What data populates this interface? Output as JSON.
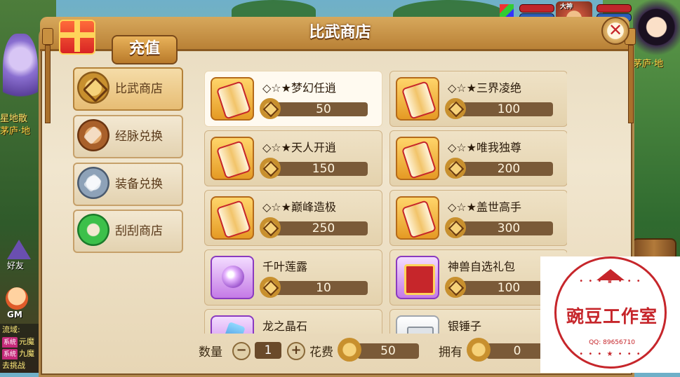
{
  "shop": {
    "title": "比武商店",
    "recharge_label": "充值",
    "close_glyph": "✕"
  },
  "tabs": [
    {
      "label": "比武商店",
      "icon": "crossed-swords-coin-icon",
      "active": true
    },
    {
      "label": "经脉兑换",
      "icon": "bronze-coin-icon",
      "active": false
    },
    {
      "label": "装备兑换",
      "icon": "silver-coin-icon",
      "active": false
    },
    {
      "label": "刮刮商店",
      "icon": "jade-ring-icon",
      "active": false
    }
  ],
  "items": [
    {
      "name": "◇☆★梦幻任逍",
      "price": "50",
      "icon": "scroll-icon"
    },
    {
      "name": "◇☆★三界凌绝",
      "price": "100",
      "icon": "scroll-icon"
    },
    {
      "name": "◇☆★天人开逍",
      "price": "150",
      "icon": "scroll-icon"
    },
    {
      "name": "◇☆★唯我独尊",
      "price": "200",
      "icon": "scroll-icon"
    },
    {
      "name": "◇☆★巅峰造极",
      "price": "250",
      "icon": "scroll-icon"
    },
    {
      "name": "◇☆★盖世高手",
      "price": "300",
      "icon": "scroll-icon"
    },
    {
      "name": "千叶莲露",
      "price": "10",
      "icon": "potion-icon"
    },
    {
      "name": "神兽自选礼包",
      "price": "100",
      "icon": "gift-box-icon"
    },
    {
      "name": "龙之晶石",
      "price": "",
      "icon": "crystal-icon"
    },
    {
      "name": "银锤子",
      "price": "",
      "icon": "hammer-icon"
    }
  ],
  "purchase": {
    "qty_label": "数量",
    "qty_value": "1",
    "minus": "−",
    "plus": "+",
    "cost_label": "花费",
    "cost_value": "50",
    "own_label": "拥有",
    "own_value": "0"
  },
  "hud": {
    "portrait_title": "大神",
    "left_player_name_1": "星地散",
    "left_player_name_2": "茅庐·地",
    "right_player_name": "茅庐·地"
  },
  "side_buttons": {
    "friend_label": "好友",
    "gm_label": "GM"
  },
  "chat": {
    "lines": [
      {
        "tag": "",
        "text": "流域:"
      },
      {
        "tag": "系统",
        "text": "元魔"
      },
      {
        "tag": "系统",
        "text": "九魔"
      },
      {
        "tag": "",
        "text": "去挑战"
      }
    ]
  },
  "watermark": {
    "title": "豌豆工作室",
    "qq": "QQ: 89656710",
    "dots_top": "• • • ♛ • • •",
    "dots_bottom": "• • • ★ • • •"
  },
  "colors": {
    "panel_bg": "#f1e6cf",
    "title_bar": "#c8903e",
    "price_bar": "#7a5a38",
    "accent_red": "#c6262b"
  }
}
